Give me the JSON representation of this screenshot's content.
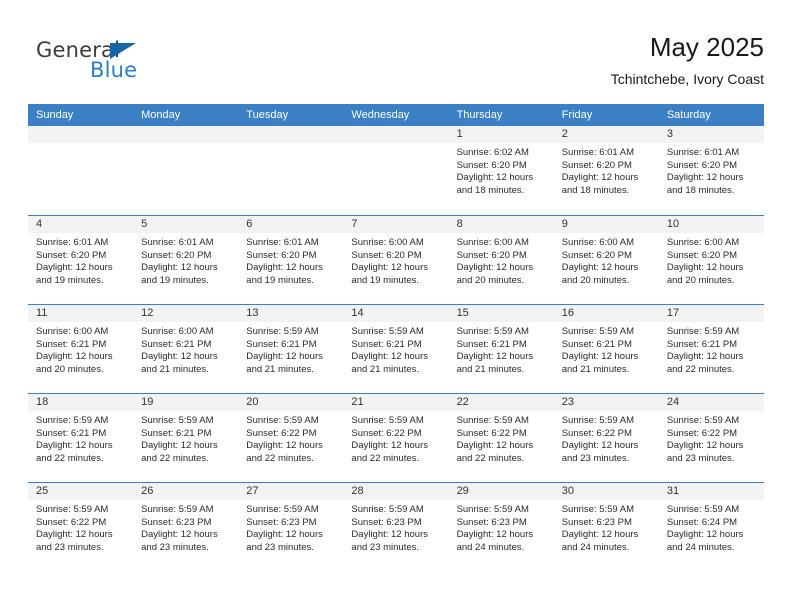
{
  "brand": {
    "word_one": "General",
    "word_two": "Blue",
    "triangle_icon": "triangle-icon",
    "colors": {
      "general_text": "#3b3b3b",
      "blue_text": "#2b7fc4",
      "triangle": "#1565a8"
    }
  },
  "header": {
    "title": "May 2025",
    "subtitle": "Tchintchebe, Ivory Coast"
  },
  "calendar": {
    "accent_color": "#3b7fc4",
    "daynum_band_color": "#f2f2f2",
    "weekday_headers": [
      "Sunday",
      "Monday",
      "Tuesday",
      "Wednesday",
      "Thursday",
      "Friday",
      "Saturday"
    ],
    "weeks": [
      [
        {
          "day": "",
          "sunrise": "",
          "sunset": "",
          "daylight_a": "",
          "daylight_b": ""
        },
        {
          "day": "",
          "sunrise": "",
          "sunset": "",
          "daylight_a": "",
          "daylight_b": ""
        },
        {
          "day": "",
          "sunrise": "",
          "sunset": "",
          "daylight_a": "",
          "daylight_b": ""
        },
        {
          "day": "",
          "sunrise": "",
          "sunset": "",
          "daylight_a": "",
          "daylight_b": ""
        },
        {
          "day": "1",
          "sunrise": "Sunrise: 6:02 AM",
          "sunset": "Sunset: 6:20 PM",
          "daylight_a": "Daylight: 12 hours",
          "daylight_b": "and 18 minutes."
        },
        {
          "day": "2",
          "sunrise": "Sunrise: 6:01 AM",
          "sunset": "Sunset: 6:20 PM",
          "daylight_a": "Daylight: 12 hours",
          "daylight_b": "and 18 minutes."
        },
        {
          "day": "3",
          "sunrise": "Sunrise: 6:01 AM",
          "sunset": "Sunset: 6:20 PM",
          "daylight_a": "Daylight: 12 hours",
          "daylight_b": "and 18 minutes."
        }
      ],
      [
        {
          "day": "4",
          "sunrise": "Sunrise: 6:01 AM",
          "sunset": "Sunset: 6:20 PM",
          "daylight_a": "Daylight: 12 hours",
          "daylight_b": "and 19 minutes."
        },
        {
          "day": "5",
          "sunrise": "Sunrise: 6:01 AM",
          "sunset": "Sunset: 6:20 PM",
          "daylight_a": "Daylight: 12 hours",
          "daylight_b": "and 19 minutes."
        },
        {
          "day": "6",
          "sunrise": "Sunrise: 6:01 AM",
          "sunset": "Sunset: 6:20 PM",
          "daylight_a": "Daylight: 12 hours",
          "daylight_b": "and 19 minutes."
        },
        {
          "day": "7",
          "sunrise": "Sunrise: 6:00 AM",
          "sunset": "Sunset: 6:20 PM",
          "daylight_a": "Daylight: 12 hours",
          "daylight_b": "and 19 minutes."
        },
        {
          "day": "8",
          "sunrise": "Sunrise: 6:00 AM",
          "sunset": "Sunset: 6:20 PM",
          "daylight_a": "Daylight: 12 hours",
          "daylight_b": "and 20 minutes."
        },
        {
          "day": "9",
          "sunrise": "Sunrise: 6:00 AM",
          "sunset": "Sunset: 6:20 PM",
          "daylight_a": "Daylight: 12 hours",
          "daylight_b": "and 20 minutes."
        },
        {
          "day": "10",
          "sunrise": "Sunrise: 6:00 AM",
          "sunset": "Sunset: 6:20 PM",
          "daylight_a": "Daylight: 12 hours",
          "daylight_b": "and 20 minutes."
        }
      ],
      [
        {
          "day": "11",
          "sunrise": "Sunrise: 6:00 AM",
          "sunset": "Sunset: 6:21 PM",
          "daylight_a": "Daylight: 12 hours",
          "daylight_b": "and 20 minutes."
        },
        {
          "day": "12",
          "sunrise": "Sunrise: 6:00 AM",
          "sunset": "Sunset: 6:21 PM",
          "daylight_a": "Daylight: 12 hours",
          "daylight_b": "and 21 minutes."
        },
        {
          "day": "13",
          "sunrise": "Sunrise: 5:59 AM",
          "sunset": "Sunset: 6:21 PM",
          "daylight_a": "Daylight: 12 hours",
          "daylight_b": "and 21 minutes."
        },
        {
          "day": "14",
          "sunrise": "Sunrise: 5:59 AM",
          "sunset": "Sunset: 6:21 PM",
          "daylight_a": "Daylight: 12 hours",
          "daylight_b": "and 21 minutes."
        },
        {
          "day": "15",
          "sunrise": "Sunrise: 5:59 AM",
          "sunset": "Sunset: 6:21 PM",
          "daylight_a": "Daylight: 12 hours",
          "daylight_b": "and 21 minutes."
        },
        {
          "day": "16",
          "sunrise": "Sunrise: 5:59 AM",
          "sunset": "Sunset: 6:21 PM",
          "daylight_a": "Daylight: 12 hours",
          "daylight_b": "and 21 minutes."
        },
        {
          "day": "17",
          "sunrise": "Sunrise: 5:59 AM",
          "sunset": "Sunset: 6:21 PM",
          "daylight_a": "Daylight: 12 hours",
          "daylight_b": "and 22 minutes."
        }
      ],
      [
        {
          "day": "18",
          "sunrise": "Sunrise: 5:59 AM",
          "sunset": "Sunset: 6:21 PM",
          "daylight_a": "Daylight: 12 hours",
          "daylight_b": "and 22 minutes."
        },
        {
          "day": "19",
          "sunrise": "Sunrise: 5:59 AM",
          "sunset": "Sunset: 6:21 PM",
          "daylight_a": "Daylight: 12 hours",
          "daylight_b": "and 22 minutes."
        },
        {
          "day": "20",
          "sunrise": "Sunrise: 5:59 AM",
          "sunset": "Sunset: 6:22 PM",
          "daylight_a": "Daylight: 12 hours",
          "daylight_b": "and 22 minutes."
        },
        {
          "day": "21",
          "sunrise": "Sunrise: 5:59 AM",
          "sunset": "Sunset: 6:22 PM",
          "daylight_a": "Daylight: 12 hours",
          "daylight_b": "and 22 minutes."
        },
        {
          "day": "22",
          "sunrise": "Sunrise: 5:59 AM",
          "sunset": "Sunset: 6:22 PM",
          "daylight_a": "Daylight: 12 hours",
          "daylight_b": "and 22 minutes."
        },
        {
          "day": "23",
          "sunrise": "Sunrise: 5:59 AM",
          "sunset": "Sunset: 6:22 PM",
          "daylight_a": "Daylight: 12 hours",
          "daylight_b": "and 23 minutes."
        },
        {
          "day": "24",
          "sunrise": "Sunrise: 5:59 AM",
          "sunset": "Sunset: 6:22 PM",
          "daylight_a": "Daylight: 12 hours",
          "daylight_b": "and 23 minutes."
        }
      ],
      [
        {
          "day": "25",
          "sunrise": "Sunrise: 5:59 AM",
          "sunset": "Sunset: 6:22 PM",
          "daylight_a": "Daylight: 12 hours",
          "daylight_b": "and 23 minutes."
        },
        {
          "day": "26",
          "sunrise": "Sunrise: 5:59 AM",
          "sunset": "Sunset: 6:23 PM",
          "daylight_a": "Daylight: 12 hours",
          "daylight_b": "and 23 minutes."
        },
        {
          "day": "27",
          "sunrise": "Sunrise: 5:59 AM",
          "sunset": "Sunset: 6:23 PM",
          "daylight_a": "Daylight: 12 hours",
          "daylight_b": "and 23 minutes."
        },
        {
          "day": "28",
          "sunrise": "Sunrise: 5:59 AM",
          "sunset": "Sunset: 6:23 PM",
          "daylight_a": "Daylight: 12 hours",
          "daylight_b": "and 23 minutes."
        },
        {
          "day": "29",
          "sunrise": "Sunrise: 5:59 AM",
          "sunset": "Sunset: 6:23 PM",
          "daylight_a": "Daylight: 12 hours",
          "daylight_b": "and 24 minutes."
        },
        {
          "day": "30",
          "sunrise": "Sunrise: 5:59 AM",
          "sunset": "Sunset: 6:23 PM",
          "daylight_a": "Daylight: 12 hours",
          "daylight_b": "and 24 minutes."
        },
        {
          "day": "31",
          "sunrise": "Sunrise: 5:59 AM",
          "sunset": "Sunset: 6:24 PM",
          "daylight_a": "Daylight: 12 hours",
          "daylight_b": "and 24 minutes."
        }
      ]
    ]
  }
}
